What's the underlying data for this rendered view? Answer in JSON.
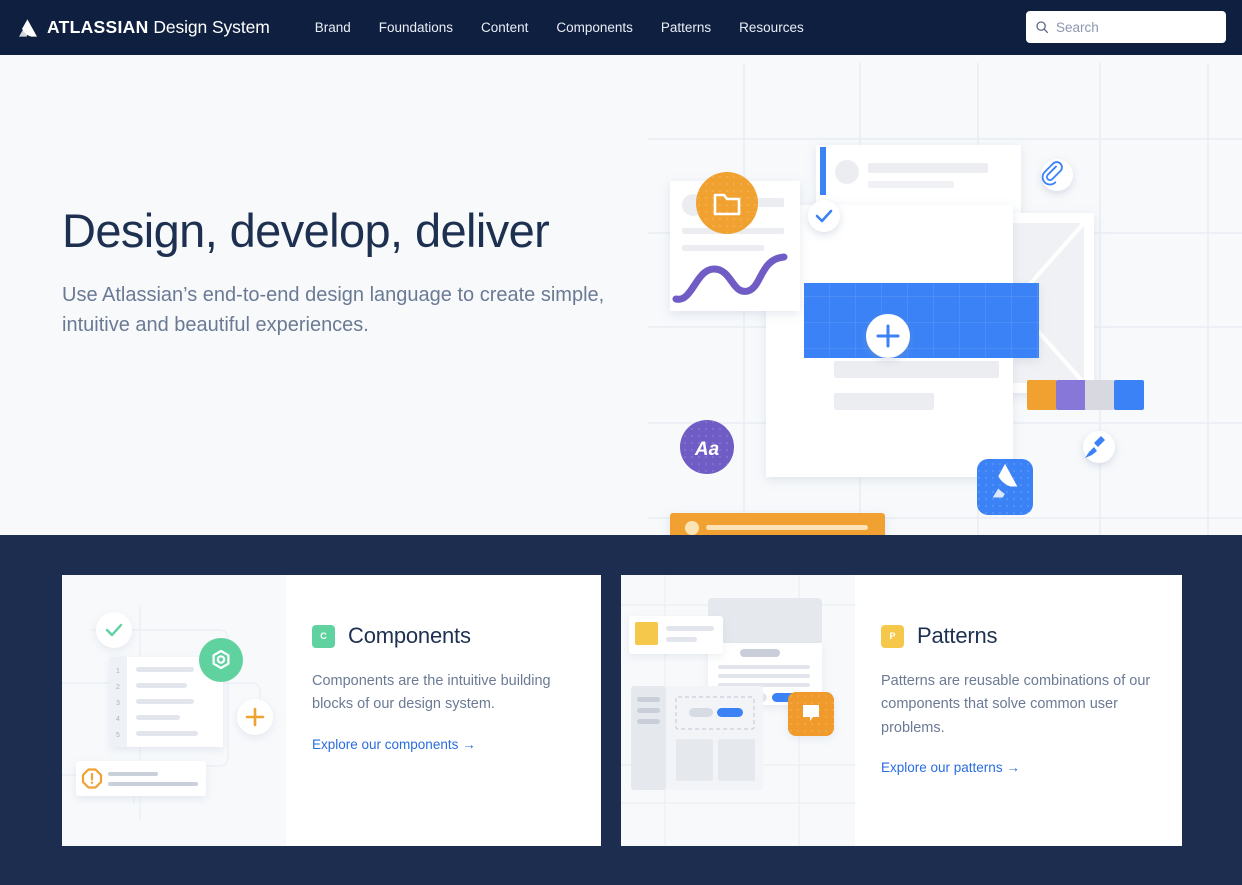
{
  "header": {
    "logo_icon": "atlassian-logo-icon",
    "brand_bold": "ATLASSIAN",
    "brand_light": "Design System",
    "nav": [
      {
        "label": "Brand"
      },
      {
        "label": "Foundations"
      },
      {
        "label": "Content"
      },
      {
        "label": "Components"
      },
      {
        "label": "Patterns"
      },
      {
        "label": "Resources"
      }
    ],
    "search": {
      "icon": "search-icon",
      "placeholder": "Search",
      "value": ""
    },
    "bg_color": "#0f1f40"
  },
  "hero": {
    "title": "Design, develop, deliver",
    "subtitle": "Use Atlassian’s end-to-end design language to create simple, intuitive and beautiful experiences.",
    "bg_color": "#f7f9fb",
    "title_color": "#1e3050",
    "subtitle_color": "#6b7a94",
    "illustration": {
      "name": "design-system-hero-illustration",
      "badges": [
        {
          "name": "folder-badge",
          "icon": "folder-icon",
          "color": "#f0a130"
        },
        {
          "name": "check-badge",
          "icon": "check-icon",
          "color": "#3b82f6"
        },
        {
          "name": "attachment-badge",
          "icon": "paperclip-icon",
          "color": "#3b82f6"
        },
        {
          "name": "typography-badge",
          "icon": "Aa",
          "color": "#6f5cc4"
        },
        {
          "name": "brush-badge",
          "icon": "brush-icon",
          "color": "#3b82f6"
        },
        {
          "name": "add-button",
          "icon": "plus-icon",
          "color": "#3b82f6"
        },
        {
          "name": "atlassian-tile",
          "icon": "atlassian-logo-icon",
          "color": "#3b82f6"
        }
      ],
      "swatches": [
        "#f0a130",
        "#8777d9",
        "#d8d8e0",
        "#3b82f6"
      ],
      "panel_color": "#3b82f6",
      "progress_bar_color": "#f0a130"
    }
  },
  "cards_section": {
    "bg_color": "#1d2d4f",
    "cards": [
      {
        "badge_letter": "C",
        "badge_color": "#5fd2a0",
        "title": "Components",
        "description": "Components are the intuitive building blocks of our design system.",
        "link_label": "Explore our components →",
        "link_color": "#2a6ce0",
        "illustration": {
          "name": "components-illustration",
          "list_numbers": [
            "1",
            "2",
            "3",
            "4",
            "5"
          ],
          "badges": [
            {
              "name": "check-badge",
              "icon": "check-icon",
              "color": "#5fd2a0"
            },
            {
              "name": "hexagon-badge",
              "icon": "hexagon-icon",
              "color": "#5fd2a0"
            },
            {
              "name": "plus-badge",
              "icon": "plus-icon",
              "color": "#f0a130"
            },
            {
              "name": "warning-badge",
              "icon": "warning-icon",
              "color": "#f0a130"
            }
          ]
        }
      },
      {
        "badge_letter": "P",
        "badge_color": "#f5c84c",
        "title": "Patterns",
        "description": "Patterns are reusable combinations of our components that solve common user problems.",
        "link_label": "Explore our patterns →",
        "link_color": "#2a6ce0",
        "illustration": {
          "name": "patterns-illustration",
          "badges": [
            {
              "name": "swatch-tile",
              "icon": "square-icon",
              "color": "#f5c84c"
            },
            {
              "name": "message-tile",
              "icon": "speech-bubble-icon",
              "color": "#ef9a2a"
            }
          ],
          "button_color": "#3b82f6"
        }
      }
    ]
  }
}
